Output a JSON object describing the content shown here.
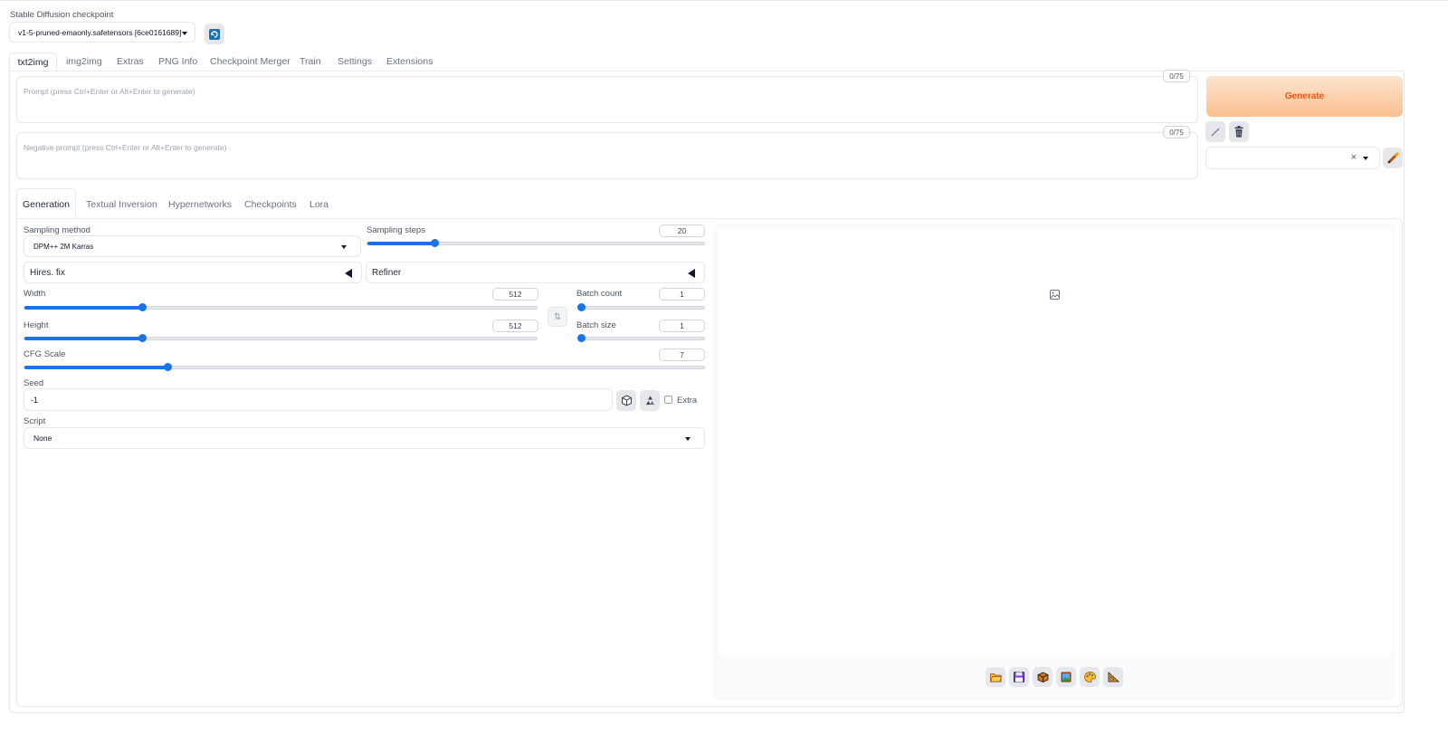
{
  "checkpoint": {
    "label": "Stable Diffusion checkpoint",
    "value": "v1-5-pruned-emaonly.safetensors [6ce0161689]"
  },
  "main_tabs": [
    "txt2img",
    "img2img",
    "Extras",
    "PNG Info",
    "Checkpoint Merger",
    "Train",
    "Settings",
    "Extensions"
  ],
  "prompt": {
    "placeholder": "Prompt (press Ctrl+Enter or Alt+Enter to generate)",
    "counter": "0/75"
  },
  "negative_prompt": {
    "placeholder": "Negative prompt (press Ctrl+Enter or Alt+Enter to generate)",
    "counter": "0/75"
  },
  "generate_label": "Generate",
  "clear_symbol": "×",
  "sub_tabs": [
    "Generation",
    "Textual Inversion",
    "Hypernetworks",
    "Checkpoints",
    "Lora"
  ],
  "sampling_method": {
    "label": "Sampling method",
    "value": "DPM++ 2M Karras"
  },
  "sampling_steps": {
    "label": "Sampling steps",
    "value": "20",
    "fraction": 0.2
  },
  "hires_fix": {
    "label": "Hires. fix"
  },
  "refiner": {
    "label": "Refiner"
  },
  "width": {
    "label": "Width",
    "value": "512",
    "fraction": 0.23
  },
  "height": {
    "label": "Height",
    "value": "512",
    "fraction": 0.23
  },
  "swap_symbol": "⇅",
  "batch_count": {
    "label": "Batch count",
    "value": "1",
    "fraction": 0.0
  },
  "batch_size": {
    "label": "Batch size",
    "value": "1",
    "fraction": 0.0
  },
  "cfg_scale": {
    "label": "CFG Scale",
    "value": "7",
    "fraction": 0.21
  },
  "seed": {
    "label": "Seed",
    "value": "-1",
    "extra_label": "Extra"
  },
  "script": {
    "label": "Script",
    "value": "None"
  },
  "colors": {
    "accent": "#1a73e8",
    "generate_text": "#ea580c"
  }
}
